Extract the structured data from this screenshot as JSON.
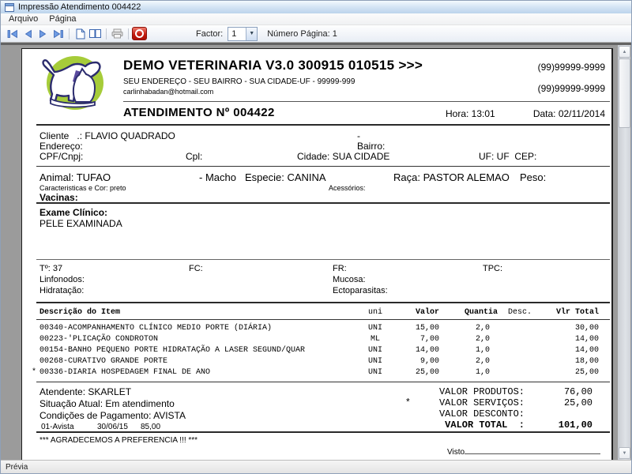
{
  "window": {
    "title": "Impressão Atendimento 004422"
  },
  "menubar": {
    "items": [
      {
        "label": "Arquivo"
      },
      {
        "label": "Página"
      }
    ]
  },
  "toolbar": {
    "factor_label": "Factor:",
    "factor_value": "1",
    "page_number_label": "Número Página: 1"
  },
  "statusbar": {
    "text": "Prévia"
  },
  "colors": {
    "logo_green": "#a6cc39",
    "logo_outline": "#2c2c6e",
    "logo_purple": "#5a4a9e",
    "nav_blue": "#6f9ce3",
    "stop_red": "#c2170a"
  },
  "document": {
    "header": {
      "company": "DEMO VETERINARIA V3.0 300915 010515 >>>",
      "address": "SEU ENDEREÇO - SEU BAIRRO - SUA CIDADE-UF - 99999-999",
      "email": "carlinhabadan@hotmail.com",
      "phone1": "(99)99999-9999",
      "phone2": "(99)99999-9999",
      "atendimento": "ATENDIMENTO Nº 004422",
      "hora": "Hora: 13:01",
      "data": "Data: 02/11/2014"
    },
    "client": {
      "cliente_label": "Cliente   .: ",
      "cliente_value": "FLAVIO QUADRADO",
      "dash": "-",
      "endereco_label": "Endereço:",
      "bairro_label": "Bairro:",
      "cpf_label": "CPF/Cnpj:",
      "cpl_label": "Cpl:",
      "cidade": "Cidade: SUA CIDADE",
      "uf_cep": "UF: UF  CEP:"
    },
    "animal": {
      "animal": "Animal: TUFAO",
      "sexo": "- Macho",
      "especie": "Especie: CANINA",
      "raca": "Raça: PASTOR ALEMAO",
      "peso": "Peso:",
      "caracteristicas": "Caracteristicas e Cor: preto",
      "acessorios": "Acessórios:",
      "vacinas": "Vacinas:"
    },
    "exam": {
      "title": "Exame Clínico:",
      "text": "PELE EXAMINADA"
    },
    "vitals": {
      "temp": "Tº: 37",
      "fc": "FC:",
      "fr": "FR:",
      "tpc": "TPC:",
      "linfonodos": "Linfonodos:",
      "mucosa": "Mucosa:",
      "hidratacao": "Hidratação:",
      "ectoparasitas": "Ectoparasitas:"
    },
    "items": {
      "headers": {
        "desc": "Descrição do Item",
        "uni": "uni",
        "valor": "Valor",
        "quantia": "Quantia",
        "desconto": "Desc.",
        "total": "Vlr Total"
      },
      "rows": [
        {
          "star": "",
          "desc": "00340-ACOMPANHAMENTO CLÍNICO MEDIO PORTE (DIÁRIA)",
          "uni": "UNI",
          "valor": "15,00",
          "quantia": "2,0",
          "desconto": "",
          "total": "30,00"
        },
        {
          "star": "",
          "desc": "00223-'PLICAÇÃO CONDROTON",
          "uni": "ML",
          "valor": "7,00",
          "quantia": "2,0",
          "desconto": "",
          "total": "14,00"
        },
        {
          "star": "",
          "desc": "00154-BANHO PEQUENO PORTE HIDRATAÇÃO A LASER SEGUND/QUAR",
          "uni": "UNI",
          "valor": "14,00",
          "quantia": "1,0",
          "desconto": "",
          "total": "14,00"
        },
        {
          "star": "",
          "desc": "00268-CURATIVO GRANDE PORTE",
          "uni": "UNI",
          "valor": "9,00",
          "quantia": "2,0",
          "desconto": "",
          "total": "18,00"
        },
        {
          "star": "*",
          "desc": "00336-DIARIA HOSPEDAGEM FINAL DE ANO",
          "uni": "UNI",
          "valor": "25,00",
          "quantia": "1,0",
          "desconto": "",
          "total": "25,00"
        }
      ]
    },
    "footer": {
      "atendente": "Atendente: SKARLET",
      "situacao": "Situação Atual: Em atendimento",
      "condicoes": "Condições de Pagamento: AVISTA",
      "pagamento": {
        "forma": "01-Avista",
        "data": "30/06/15",
        "valor": "85,00"
      },
      "totais": [
        {
          "star": "",
          "label": "VALOR PRODUTOS:",
          "value": "76,00"
        },
        {
          "star": "*",
          "label": "VALOR SERVIÇOS:",
          "value": "25,00"
        },
        {
          "star": "",
          "label": "VALOR DESCONTO:",
          "value": ""
        },
        {
          "star": "",
          "label": "VALOR TOTAL  :",
          "value": "101,00"
        }
      ],
      "agradecimento": "*** AGRADECEMOS A PREFERENCIA !!! ***",
      "visto": "Visto"
    }
  }
}
